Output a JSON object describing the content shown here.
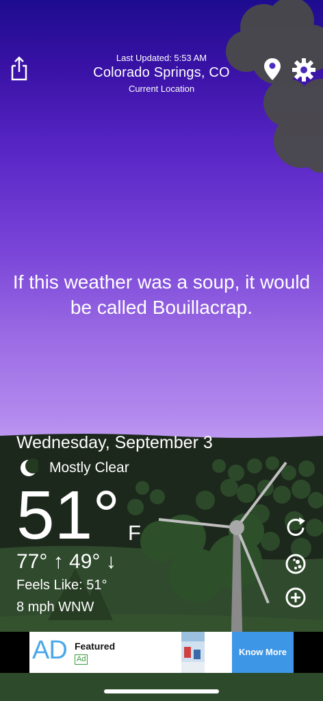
{
  "header": {
    "last_updated": "Last Updated: 5:53 AM",
    "city": "Colorado Springs, CO",
    "location_label": "Current Location"
  },
  "toolbar": {
    "share_icon": "share-icon",
    "location_icon": "map-pin-icon",
    "settings_icon": "gear-icon"
  },
  "quote": "If this weather was a soup, it would be called Bouillacrap.",
  "weather": {
    "date": "Wednesday, September 3",
    "condition": "Mostly Clear",
    "condition_icon": "crescent-moon-icon",
    "temperature": "51°",
    "unit": "F",
    "high_low": "77° ↑  49° ↓",
    "feels_like": "Feels Like: 51°",
    "wind": "8 mph WNW"
  },
  "side_actions": {
    "refresh_icon": "refresh-icon",
    "radar_icon": "radar-icon",
    "add_icon": "add-location-icon"
  },
  "ad": {
    "logo": "AD",
    "title": "Featured",
    "badge": "Ad",
    "cta": "Know More"
  },
  "colors": {
    "sky_top": "#1d0c8f",
    "sky_bottom": "#c2a0f2",
    "hill": "#2f3f2c",
    "ad_accent": "#3d96e6"
  }
}
